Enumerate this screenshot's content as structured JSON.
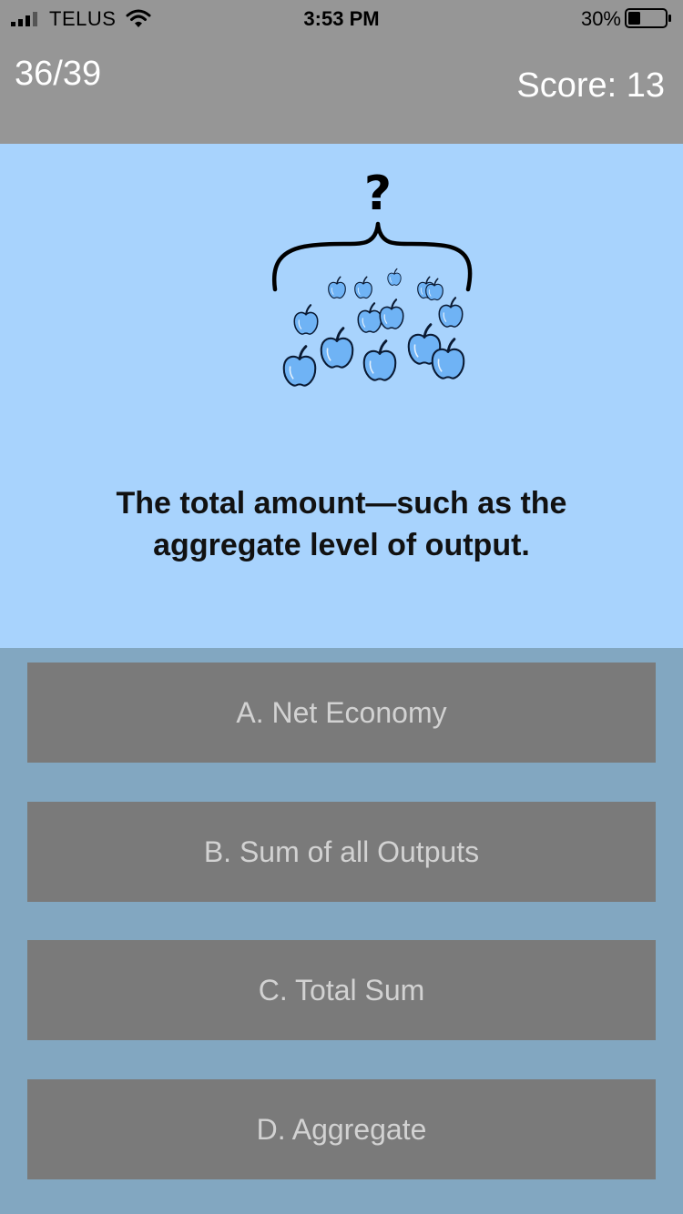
{
  "status_bar": {
    "carrier": "TELUS",
    "time": "3:53 PM",
    "battery": "30%",
    "icons": [
      "signal-icon",
      "wifi-icon",
      "battery-icon"
    ]
  },
  "header": {
    "progress": "36/39",
    "score": "Score: 13"
  },
  "question": {
    "text": "The total amount—such as the aggregate level of output.",
    "illustration": "apples-grouped-under-brace-with-question-mark"
  },
  "answers": [
    {
      "label": "A. Net Economy"
    },
    {
      "label": "B. Sum of all Outputs"
    },
    {
      "label": "C. Total Sum"
    },
    {
      "label": "D. Aggregate"
    }
  ],
  "colors": {
    "header_bg": "#969696",
    "question_bg": "#a8d3fd",
    "answers_bg": "#82a7c1",
    "button_bg": "#7a7a7a",
    "button_text": "#d2d2d2",
    "apple": "#6fb3f5"
  }
}
